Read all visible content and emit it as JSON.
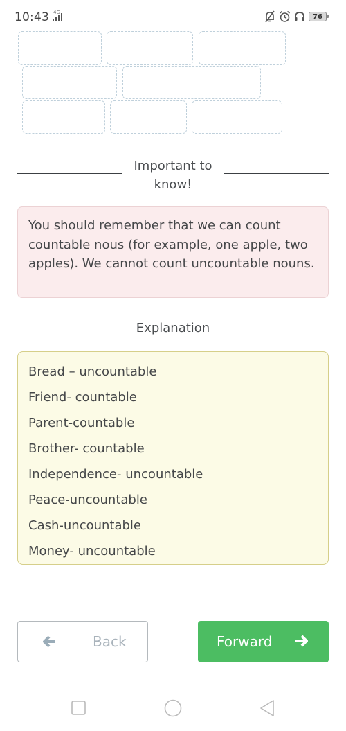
{
  "status_bar": {
    "time": "10:43",
    "network": "4G",
    "icons": [
      "notifications-off-icon",
      "alarm-icon",
      "headset-icon"
    ],
    "battery": "76"
  },
  "answer_slots": {
    "count": 8,
    "rows": [
      3,
      2,
      3
    ]
  },
  "important": {
    "heading_line1": "Important to",
    "heading_line2": "know!",
    "text": "You should remember that we can count countable nous (for example, one apple, two apples). We cannot count uncountable nouns."
  },
  "explanation": {
    "heading": "Explanation",
    "items": [
      "Bread – uncountable",
      "Friend- countable",
      "Parent-countable",
      "Brother- countable",
      "Independence- uncountable",
      "Peace-uncountable",
      "Cash-uncountable",
      "Money- uncountable"
    ]
  },
  "navigation": {
    "back_label": "Back",
    "forward_label": "Forward"
  },
  "colors": {
    "forward_button": "#4cbd62",
    "info_background": "#fbeced",
    "explanation_background": "#fcfbe6",
    "slot_border": "#bfd0db"
  }
}
